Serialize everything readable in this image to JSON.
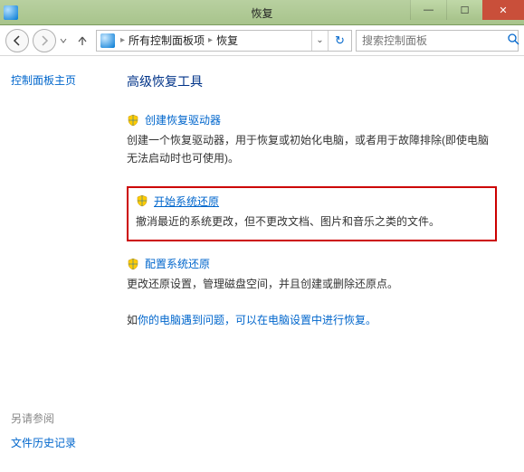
{
  "window": {
    "title": "恢复"
  },
  "nav": {
    "breadcrumb": {
      "root": "所有控制面板项",
      "current": "恢复"
    },
    "search_placeholder": "搜索控制面板"
  },
  "sidebar": {
    "home": "控制面板主页",
    "see_also": "另请参阅",
    "file_history": "文件历史记录"
  },
  "content": {
    "heading": "高级恢复工具",
    "item1": {
      "title": "创建恢复驱动器",
      "desc": "创建一个恢复驱动器，用于恢复或初始化电脑，或者用于故障排除(即使电脑无法启动时也可使用)。"
    },
    "item2": {
      "title": "开始系统还原",
      "desc": "撤消最近的系统更改，但不更改文档、图片和音乐之类的文件。"
    },
    "item3": {
      "title": "配置系统还原",
      "desc": "更改还原设置，管理磁盘空间，并且创建或删除还原点。"
    },
    "note_prefix": "如",
    "note": "你的电脑遇到问题，可以在电脑设置中进行恢复。"
  }
}
